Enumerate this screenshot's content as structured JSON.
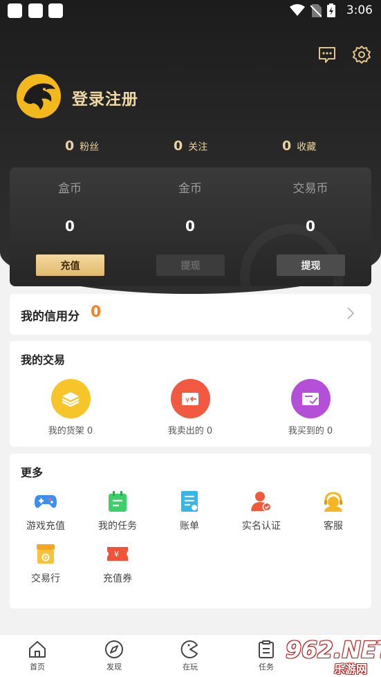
{
  "status_bar": {
    "time": "3:06"
  },
  "header": {
    "login_text": "登录注册"
  },
  "stats": [
    {
      "value": "0",
      "label": "粉丝"
    },
    {
      "value": "0",
      "label": "关注"
    },
    {
      "value": "0",
      "label": "收藏"
    }
  ],
  "wallet": [
    {
      "name": "盒币",
      "value": "0",
      "button": "充值"
    },
    {
      "name": "金币",
      "value": "0",
      "button": "提现"
    },
    {
      "name": "交易币",
      "value": "0",
      "button": "提现"
    }
  ],
  "credit": {
    "label": "我的信用分",
    "score": "0"
  },
  "trade": {
    "title": "我的交易",
    "items": [
      {
        "label": "我的货架 0",
        "color": "#f6c52a"
      },
      {
        "label": "我卖出的 0",
        "color": "#f15a40"
      },
      {
        "label": "我买到的 0",
        "color": "#b44fd8"
      }
    ]
  },
  "more": {
    "title": "更多",
    "items": [
      {
        "label": "游戏充值",
        "icon": "gamepad-icon"
      },
      {
        "label": "我的任务",
        "icon": "calendar-task-icon"
      },
      {
        "label": "账单",
        "icon": "bill-icon"
      },
      {
        "label": "实名认证",
        "icon": "verified-user-icon"
      },
      {
        "label": "客服",
        "icon": "customer-service-icon"
      },
      {
        "label": "交易行",
        "icon": "shop-icon"
      },
      {
        "label": "充值券",
        "icon": "coupon-icon"
      }
    ]
  },
  "tabs": [
    {
      "label": "首页",
      "icon": "home-icon"
    },
    {
      "label": "发现",
      "icon": "compass-icon"
    },
    {
      "label": "在玩",
      "icon": "pacman-icon"
    },
    {
      "label": "任务",
      "icon": "task-list-icon"
    }
  ],
  "watermark": {
    "line1": "962.NET",
    "line2": "乐游网"
  },
  "colors": {
    "accent_orange": "#f58220",
    "gold": "#e8d3a4"
  }
}
